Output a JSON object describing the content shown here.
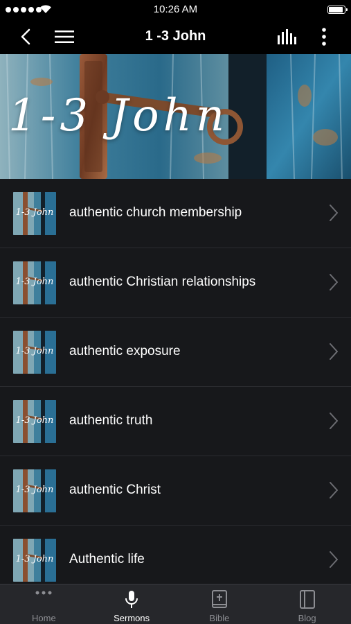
{
  "status_bar": {
    "time": "10:26 AM",
    "battery_level": 0.95
  },
  "nav": {
    "title": "1 -3 John",
    "icons": [
      "back-icon",
      "menu-icon",
      "audio-levels-icon",
      "more-vertical-icon"
    ]
  },
  "hero": {
    "title": "1-3 John"
  },
  "thumbnail_text": "1-3 John",
  "sermons": [
    {
      "title": "authentic church membership"
    },
    {
      "title": "authentic Christian relationships"
    },
    {
      "title": "authentic exposure"
    },
    {
      "title": "authentic truth"
    },
    {
      "title": "authentic Christ"
    },
    {
      "title": "Authentic life"
    }
  ],
  "tabs": [
    {
      "label": "Home",
      "icon": "more-horizontal-icon",
      "active": false
    },
    {
      "label": "Sermons",
      "icon": "microphone-icon",
      "active": true
    },
    {
      "label": "Bible",
      "icon": "bible-icon",
      "active": false
    },
    {
      "label": "Blog",
      "icon": "book-icon",
      "active": false
    }
  ],
  "colors": {
    "background": "#17181b",
    "bar": "#000000",
    "tab_bar": "#26272b",
    "inactive": "#8d8e93",
    "accent": "#ffffff"
  }
}
